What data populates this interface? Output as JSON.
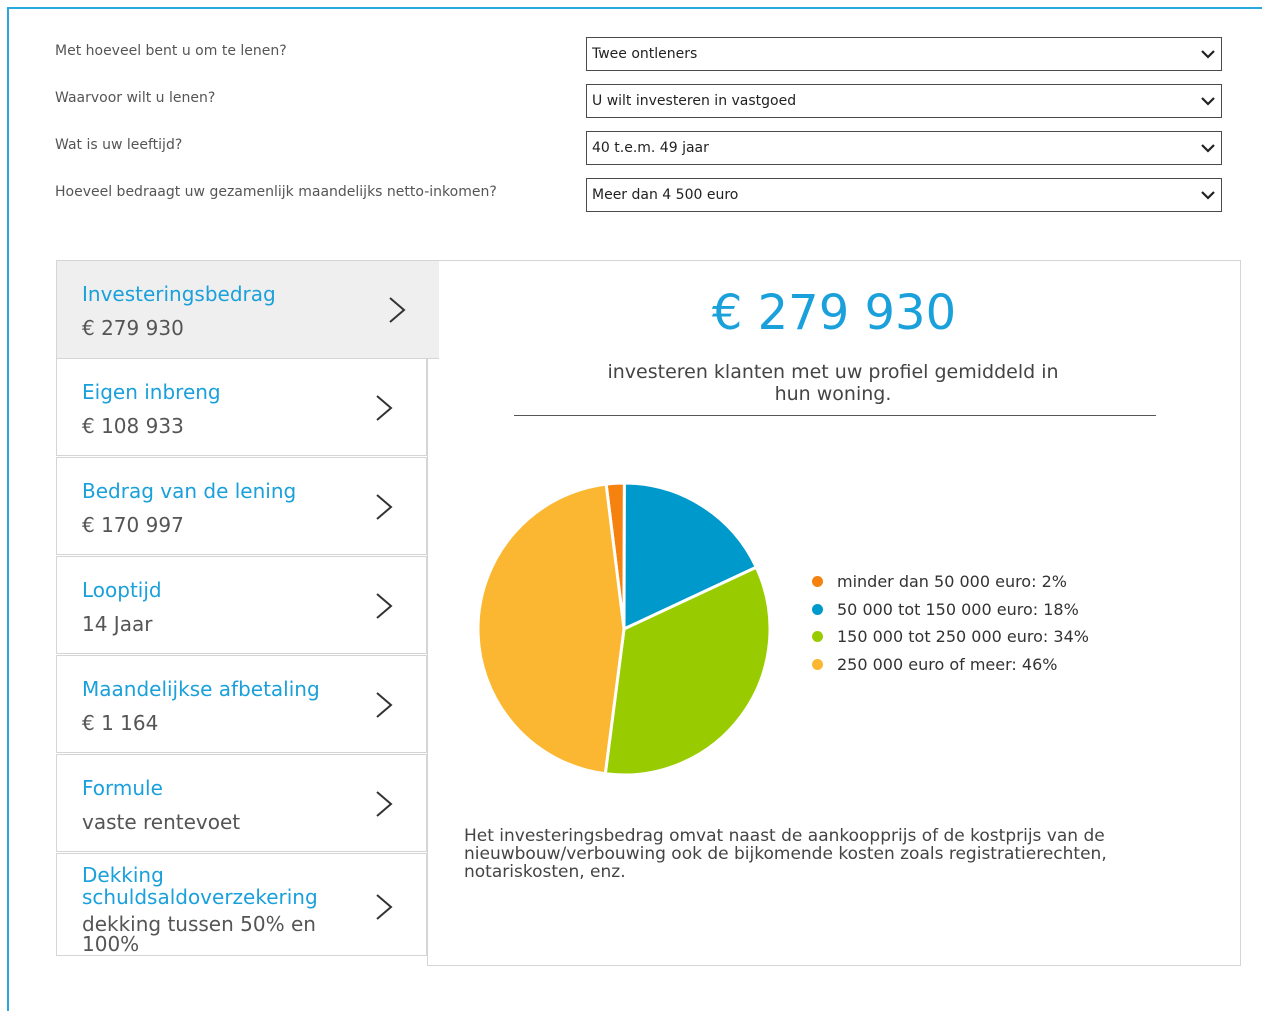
{
  "form": {
    "rows": [
      {
        "label": "Met hoeveel bent u om te lenen?",
        "value": "Twee ontleners"
      },
      {
        "label": "Waarvoor wilt u lenen?",
        "value": "U wilt investeren in vastgoed"
      },
      {
        "label": "Wat is uw leeftijd?",
        "value": "40 t.e.m. 49 jaar"
      },
      {
        "label": "Hoeveel bedraagt uw gezamenlijk maandelijks netto-inkomen?",
        "value": "Meer dan 4 500 euro"
      }
    ]
  },
  "menu": {
    "items": [
      {
        "title": "Investeringsbedrag",
        "value": "€ 279 930",
        "active": true
      },
      {
        "title": "Eigen inbreng",
        "value": "€ 108 933"
      },
      {
        "title": "Bedrag van de lening",
        "value": "€ 170 997"
      },
      {
        "title": "Looptijd",
        "value": "14 Jaar"
      },
      {
        "title": "Maandelijkse afbetaling",
        "value": "€ 1 164"
      },
      {
        "title": "Formule",
        "value": "vaste rentevoet"
      },
      {
        "title": "Dekking schuldsaldoverzekering",
        "value": "dekking tussen 50% en 100%"
      }
    ]
  },
  "panel": {
    "amount": "€ 279 930",
    "subtitle": "investeren klanten met uw profiel gemiddeld in hun woning.",
    "footnote": "Het investeringsbedrag omvat naast de aankoopprijs of de kostprijs van de nieuwbouw/verbouwing ook de bijkomende kosten zoals registratierechten, notariskosten, enz."
  },
  "chart_data": {
    "type": "pie",
    "slices": [
      {
        "label": "minder dan 50 000 euro: 2%",
        "value": 2,
        "color": "#f5820f"
      },
      {
        "label": "50 000 tot 150 000 euro: 18%",
        "value": 18,
        "color": "#0099cc"
      },
      {
        "label": "150 000 tot 250 000 euro: 34%",
        "value": 34,
        "color": "#99cc00"
      },
      {
        "label": "250 000 euro of meer: 46%",
        "value": 46,
        "color": "#fbb731"
      }
    ],
    "legend_position": "right"
  },
  "colors": {
    "accent": "#1aa0db",
    "frame": "#29a8e0"
  },
  "icons": {
    "select_arrow": "chevron-down-icon",
    "menu_arrow": "chevron-right-icon"
  }
}
